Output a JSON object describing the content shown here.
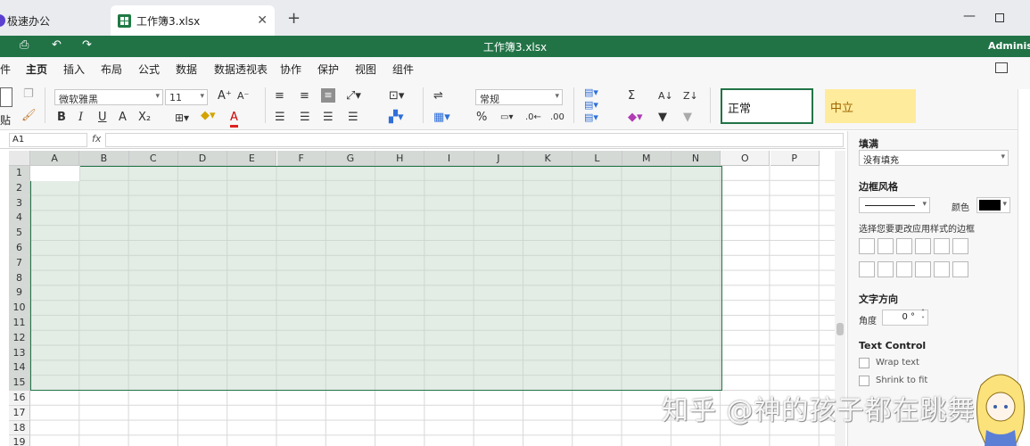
{
  "tabs": {
    "app_label": "极速办公",
    "file_label": "工作簿3.xlsx",
    "close_symbol": "✕",
    "add_symbol": "+"
  },
  "window": {
    "min_symbol": "—"
  },
  "titlebar": {
    "doc_title": "工作簿3.xlsx",
    "user": "Adminis",
    "quick_icons": [
      "print-icon",
      "undo-icon",
      "redo-icon"
    ]
  },
  "menu": {
    "items": [
      "件",
      "主页",
      "插入",
      "布局",
      "公式",
      "数据",
      "数据透视表",
      "协作",
      "保护",
      "视图",
      "组件"
    ],
    "active": "主页"
  },
  "ribbon": {
    "clipboard_label": "贴",
    "font_name": "微软雅黑",
    "font_size": "11",
    "bold": "B",
    "italic": "I",
    "underline": "U",
    "strike": "A",
    "sub": "X₂",
    "grow_font": "A⁺",
    "shrink_font": "A⁻",
    "font_color": "A",
    "number_format": "常规",
    "percent": "%",
    "sum": "Σ",
    "styles": {
      "normal": "正常",
      "neutral": "中立"
    },
    "colors": {
      "accent": "#217346",
      "neutral_bg": "#ffeb9c",
      "neutral_text": "#9c6500",
      "font_color_bar": "#e02020"
    }
  },
  "formula_bar": {
    "cell_ref": "A1",
    "fx": "fx",
    "value": ""
  },
  "grid": {
    "columns": [
      "A",
      "B",
      "C",
      "D",
      "E",
      "F",
      "G",
      "H",
      "I",
      "J",
      "K",
      "L",
      "M",
      "N",
      "O",
      "P"
    ],
    "rows": [
      "1",
      "2",
      "3",
      "4",
      "5",
      "6",
      "7",
      "8",
      "9",
      "10",
      "11",
      "12",
      "13",
      "14",
      "15",
      "16",
      "17",
      "18",
      "19"
    ],
    "selection": "A1:N15"
  },
  "panel": {
    "fill_title": "填满",
    "fill_value": "没有填充",
    "border_title": "边框风格",
    "color_label": "颜色",
    "border_hint": "选择您要更改应用样式的边框",
    "text_dir_title": "文字方向",
    "angle_label": "角度",
    "angle_value": "0 °",
    "text_control_title": "Text Control",
    "wrap_text": "Wrap text",
    "shrink_to_fit": "Shrink to fit"
  },
  "watermark": "知乎 @神的孩子都在跳舞"
}
